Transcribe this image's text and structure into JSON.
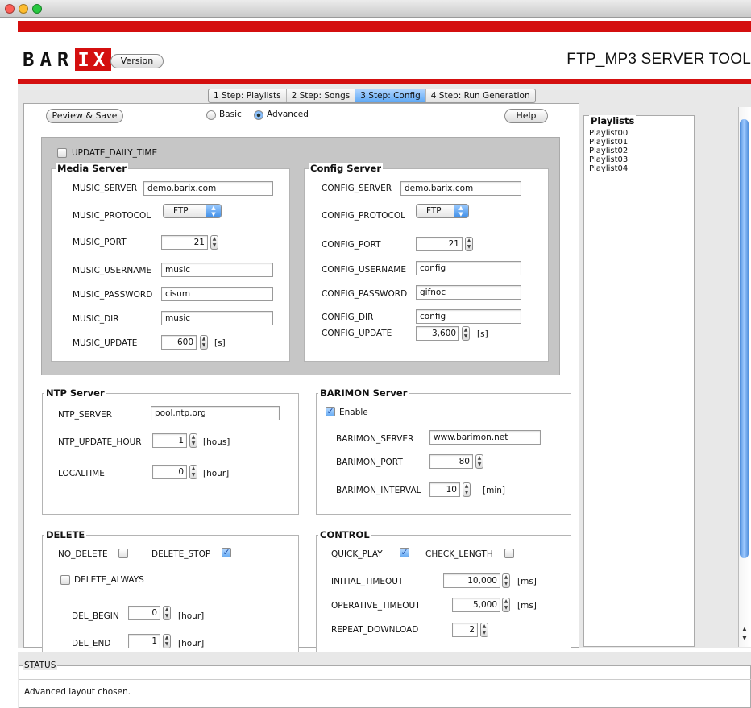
{
  "header": {
    "logo_text": "BAR",
    "logo_highlight": "IX",
    "version_button": "Version",
    "app_title": "FTP_MP3 SERVER TOOL"
  },
  "tabs": [
    "1 Step: Playlists",
    "2 Step: Songs",
    "3 Step: Config",
    "4 Step: Run Generation"
  ],
  "active_tab": "3 Step: Config",
  "toolbar": {
    "preview_save": "Peview & Save",
    "radio_basic": "Basic",
    "radio_advanced": "Advanced",
    "help": "Help"
  },
  "update_daily_time": {
    "label": "UPDATE_DAILY_TIME",
    "checked": false
  },
  "media_server": {
    "title": "Media Server",
    "server_label": "MUSIC_SERVER",
    "server_value": "demo.barix.com",
    "protocol_label": "MUSIC_PROTOCOL",
    "protocol_value": "FTP",
    "port_label": "MUSIC_PORT",
    "port_value": "21",
    "username_label": "MUSIC_USERNAME",
    "username_value": "music",
    "password_label": "MUSIC_PASSWORD",
    "password_value": "cisum",
    "dir_label": "MUSIC_DIR",
    "dir_value": "music",
    "update_label": "MUSIC_UPDATE",
    "update_value": "600",
    "update_unit": "[s]"
  },
  "config_server": {
    "title": "Config Server",
    "server_label": "CONFIG_SERVER",
    "server_value": "demo.barix.com",
    "protocol_label": "CONFIG_PROTOCOL",
    "protocol_value": "FTP",
    "port_label": "CONFIG_PORT",
    "port_value": "21",
    "username_label": "CONFIG_USERNAME",
    "username_value": "config",
    "password_label": "CONFIG_PASSWORD",
    "password_value": "gifnoc",
    "dir_label": "CONFIG_DIR",
    "dir_value": "config",
    "update_label": "CONFIG_UPDATE",
    "update_value": "3,600",
    "update_unit": "[s]"
  },
  "ntp_server": {
    "title": "NTP Server",
    "server_label": "NTP_SERVER",
    "server_value": "pool.ntp.org",
    "update_hour_label": "NTP_UPDATE_HOUR",
    "update_hour_value": "1",
    "update_hour_unit": "[hous]",
    "localtime_label": "LOCALTIME",
    "localtime_value": "0",
    "localtime_unit": "[hour]"
  },
  "barimon_server": {
    "title": "BARIMON Server",
    "enable_label": "Enable",
    "enabled": true,
    "server_label": "BARIMON_SERVER",
    "server_value": "www.barimon.net",
    "port_label": "BARIMON_PORT",
    "port_value": "80",
    "interval_label": "BARIMON_INTERVAL",
    "interval_value": "10",
    "interval_unit": "[min]"
  },
  "delete": {
    "title": "DELETE",
    "no_delete_label": "NO_DELETE",
    "no_delete": false,
    "delete_stop_label": "DELETE_STOP",
    "delete_stop": true,
    "delete_always_label": "DELETE_ALWAYS",
    "delete_always": false,
    "del_begin_label": "DEL_BEGIN",
    "del_begin_value": "0",
    "del_begin_unit": "[hour]",
    "del_end_label": "DEL_END",
    "del_end_value": "1",
    "del_end_unit": "[hour]"
  },
  "control": {
    "title": "CONTROL",
    "quick_play_label": "QUICK_PLAY",
    "quick_play": true,
    "check_length_label": "CHECK_LENGTH",
    "check_length": false,
    "initial_timeout_label": "INITIAL_TIMEOUT",
    "initial_timeout_value": "10,000",
    "initial_timeout_unit": "[ms]",
    "operative_timeout_label": "OPERATIVE_TIMEOUT",
    "operative_timeout_value": "5,000",
    "operative_timeout_unit": "[ms]",
    "repeat_download_label": "REPEAT_DOWNLOAD",
    "repeat_download_value": "2"
  },
  "playlists": {
    "title": "Playlists",
    "items": [
      "Playlist00",
      "Playlist01",
      "Playlist02",
      "Playlist03",
      "Playlist04"
    ]
  },
  "status": {
    "title": "STATUS",
    "message": "Advanced layout chosen."
  },
  "colors": {
    "accent_red": "#d40f0f",
    "selection_blue": "#5fa8f5"
  }
}
